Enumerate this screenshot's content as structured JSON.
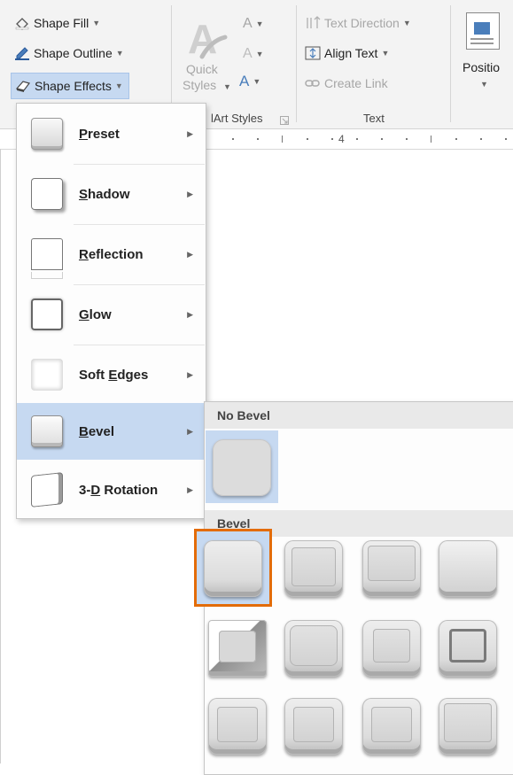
{
  "ribbon": {
    "shape_fill": "Shape Fill",
    "shape_outline": "Shape Outline",
    "shape_effects": "Shape Effects",
    "quick_styles_line1": "Quick",
    "quick_styles_line2": "Styles",
    "wordart_group_label": "lArt Styles",
    "text_direction": "Text Direction",
    "align_text": "Align Text",
    "create_link": "Create Link",
    "text_group_label": "Text",
    "position": "Positio"
  },
  "ruler": {
    "marker": "4"
  },
  "menu": {
    "items": [
      {
        "underline": "P",
        "rest": "reset",
        "active": false
      },
      {
        "underline": "S",
        "rest": "hadow",
        "active": false
      },
      {
        "underline": "R",
        "rest": "eflection",
        "active": false
      },
      {
        "underline": "G",
        "rest": "low",
        "active": false
      },
      {
        "pre": "Soft ",
        "underline": "E",
        "rest": "dges",
        "active": false
      },
      {
        "underline": "B",
        "rest": "evel",
        "active": true
      },
      {
        "pre": "3-",
        "underline": "D",
        "rest": " Rotation",
        "active": false
      }
    ]
  },
  "bevel_submenu": {
    "no_bevel_header": "No Bevel",
    "bevel_header": "Bevel",
    "selected_index": 0
  },
  "colors": {
    "highlight": "#c6d9f1",
    "selection_outline": "#e36c09"
  }
}
